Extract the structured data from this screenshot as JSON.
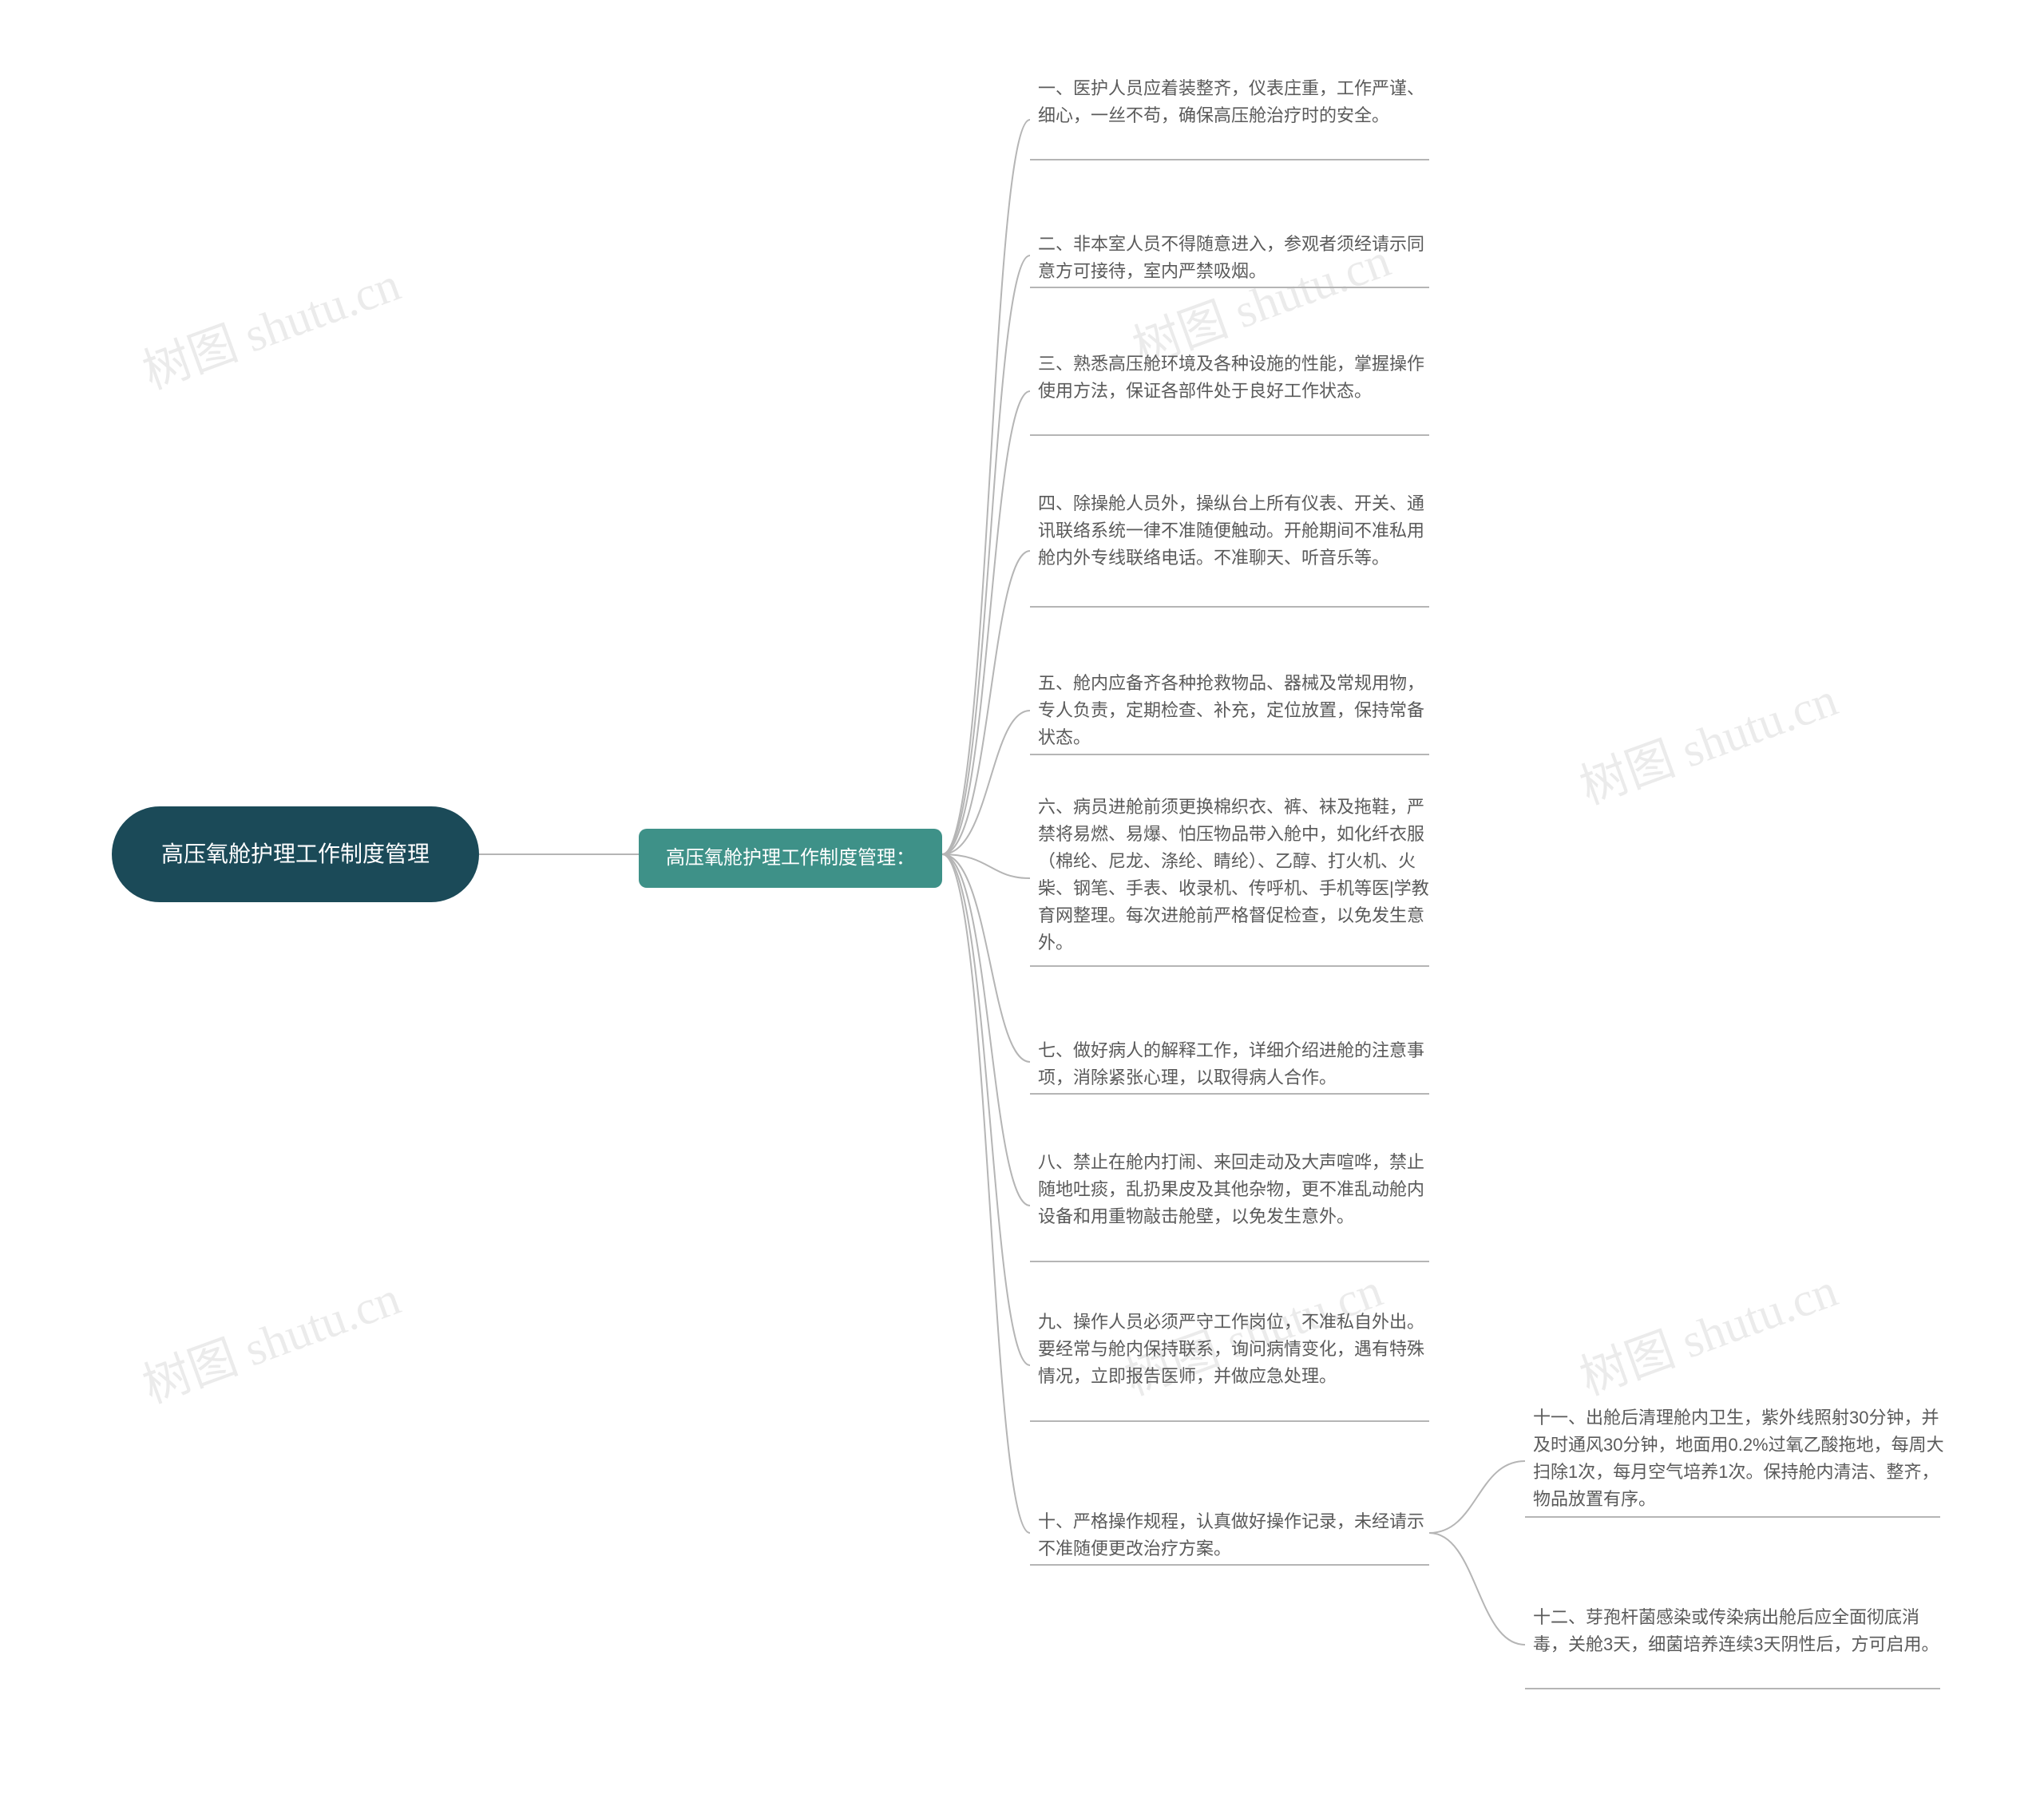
{
  "watermark": "树图 shutu.cn",
  "root": {
    "label": "高压氧舱护理工作制度管理"
  },
  "sub": {
    "label": "高压氧舱护理工作制度管理："
  },
  "items": [
    "一、医护人员应着装整齐，仪表庄重，工作严谨、细心，一丝不苟，确保高压舱治疗时的安全。",
    "二、非本室人员不得随意进入，参观者须经请示同意方可接待，室内严禁吸烟。",
    "三、熟悉高压舱环境及各种设施的性能，掌握操作使用方法，保证各部件处于良好工作状态。",
    "四、除操舱人员外，操纵台上所有仪表、开关、通讯联络系统一律不准随便触动。开舱期间不准私用舱内外专线联络电话。不准聊天、听音乐等。",
    "五、舱内应备齐各种抢救物品、器械及常规用物，专人负责，定期检查、补充，定位放置，保持常备状态。",
    "六、病员进舱前须更换棉织衣、裤、袜及拖鞋，严禁将易燃、易爆、怕压物品带入舱中，如化纤衣服（棉纶、尼龙、涤纶、睛纶）、乙醇、打火机、火柴、钢笔、手表、收录机、传呼机、手机等医|学教育网整理。每次进舱前严格督促检查，以免发生意外。",
    "七、做好病人的解释工作，详细介绍进舱的注意事项，消除紧张心理，以取得病人合作。",
    "八、禁止在舱内打闹、来回走动及大声喧哗，禁止随地吐痰，乱扔果皮及其他杂物，更不准乱动舱内设备和用重物敲击舱壁，以免发生意外。",
    "九、操作人员必须严守工作岗位，不准私自外出。要经常与舱内保持联系，询问病情变化，遇有特殊情况，立即报告医师，并做应急处理。",
    "十、严格操作规程，认真做好操作记录，未经请示不准随便更改治疗方案。"
  ],
  "subitems": [
    "十一、出舱后清理舱内卫生，紫外线照射30分钟，并及时通风30分钟，地面用0.2%过氧乙酸拖地，每周大扫除1次，每月空气培养1次。保持舱内清洁、整齐，物品放置有序。",
    "十二、芽孢杆菌感染或传染病出舱后应全面彻底消毒，关舱3天，细菌培养连续3天阴性后，方可启用。"
  ],
  "chart_data": {
    "type": "mindmap",
    "root": "高压氧舱护理工作制度管理",
    "children": [
      {
        "label": "高压氧舱护理工作制度管理：",
        "children": [
          {
            "label": "一、医护人员应着装整齐，仪表庄重，工作严谨、细心，一丝不苟，确保高压舱治疗时的安全。"
          },
          {
            "label": "二、非本室人员不得随意进入，参观者须经请示同意方可接待，室内严禁吸烟。"
          },
          {
            "label": "三、熟悉高压舱环境及各种设施的性能，掌握操作使用方法，保证各部件处于良好工作状态。"
          },
          {
            "label": "四、除操舱人员外，操纵台上所有仪表、开关、通讯联络系统一律不准随便触动。开舱期间不准私用舱内外专线联络电话。不准聊天、听音乐等。"
          },
          {
            "label": "五、舱内应备齐各种抢救物品、器械及常规用物，专人负责，定期检查、补充，定位放置，保持常备状态。"
          },
          {
            "label": "六、病员进舱前须更换棉织衣、裤、袜及拖鞋，严禁将易燃、易爆、怕压物品带入舱中，如化纤衣服（棉纶、尼龙、涤纶、睛纶）、乙醇、打火机、火柴、钢笔、手表、收录机、传呼机、手机等医|学教育网整理。每次进舱前严格督促检查，以免发生意外。"
          },
          {
            "label": "七、做好病人的解释工作，详细介绍进舱的注意事项，消除紧张心理，以取得病人合作。"
          },
          {
            "label": "八、禁止在舱内打闹、来回走动及大声喧哗，禁止随地吐痰，乱扔果皮及其他杂物，更不准乱动舱内设备和用重物敲击舱壁，以免发生意外。"
          },
          {
            "label": "九、操作人员必须严守工作岗位，不准私自外出。要经常与舱内保持联系，询问病情变化，遇有特殊情况，立即报告医师，并做应急处理。"
          },
          {
            "label": "十、严格操作规程，认真做好操作记录，未经请示不准随便更改治疗方案。",
            "children": [
              {
                "label": "十一、出舱后清理舱内卫生，紫外线照射30分钟，并及时通风30分钟，地面用0.2%过氧乙酸拖地，每周大扫除1次，每月空气培养1次。保持舱内清洁、整齐，物品放置有序。"
              },
              {
                "label": "十二、芽孢杆菌感染或传染病出舱后应全面彻底消毒，关舱3天，细菌培养连续3天阴性后，方可启用。"
              }
            ]
          }
        ]
      }
    ]
  }
}
